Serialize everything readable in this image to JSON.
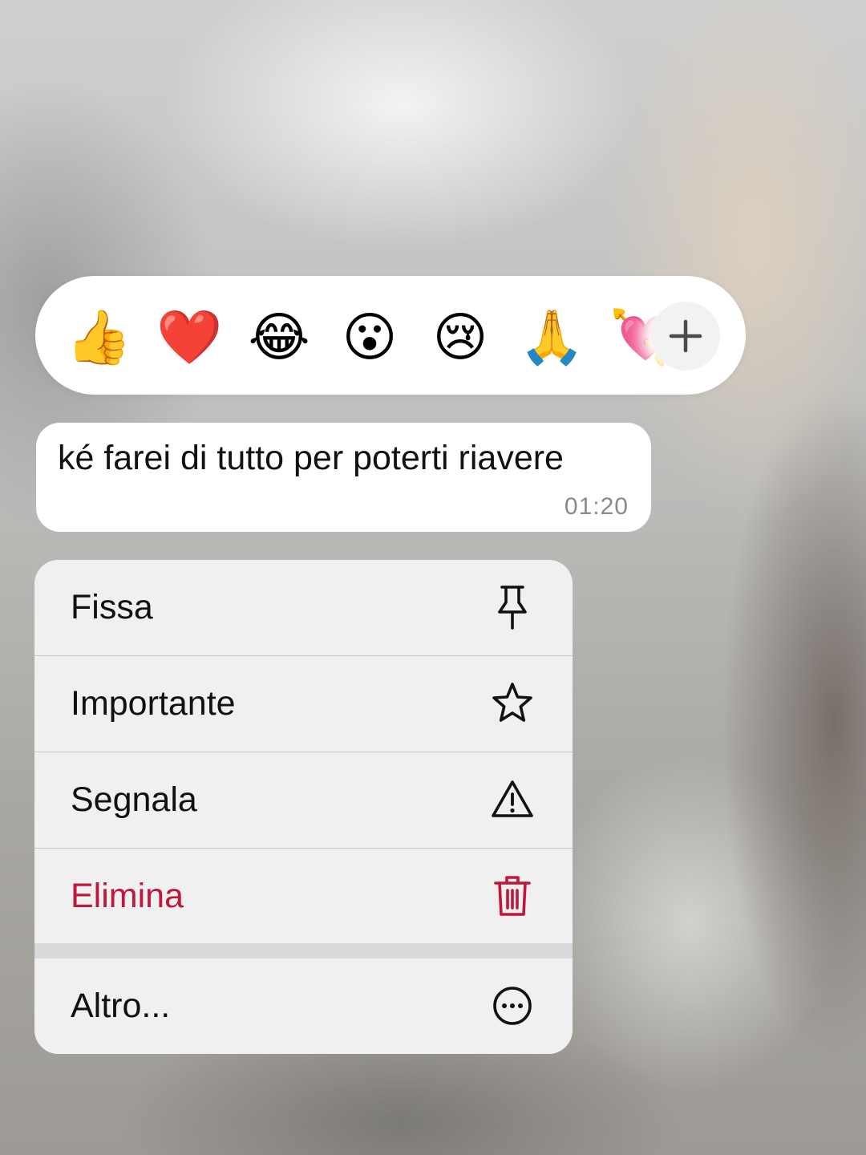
{
  "reactions": {
    "items": [
      "👍",
      "❤️",
      "😂",
      "😮",
      "😢",
      "🙏",
      "💘"
    ],
    "more_label": "+"
  },
  "message": {
    "text": "ké farei di tutto per poterti riavere",
    "time": "01:20"
  },
  "menu": {
    "items": [
      {
        "label": "Fissa",
        "icon": "pin-icon"
      },
      {
        "label": "Importante",
        "icon": "star-icon"
      },
      {
        "label": "Segnala",
        "icon": "warning-icon"
      },
      {
        "label": "Elimina",
        "icon": "trash-icon",
        "color": "#c0183d"
      },
      {
        "label": "Altro...",
        "icon": "more-icon"
      }
    ]
  }
}
